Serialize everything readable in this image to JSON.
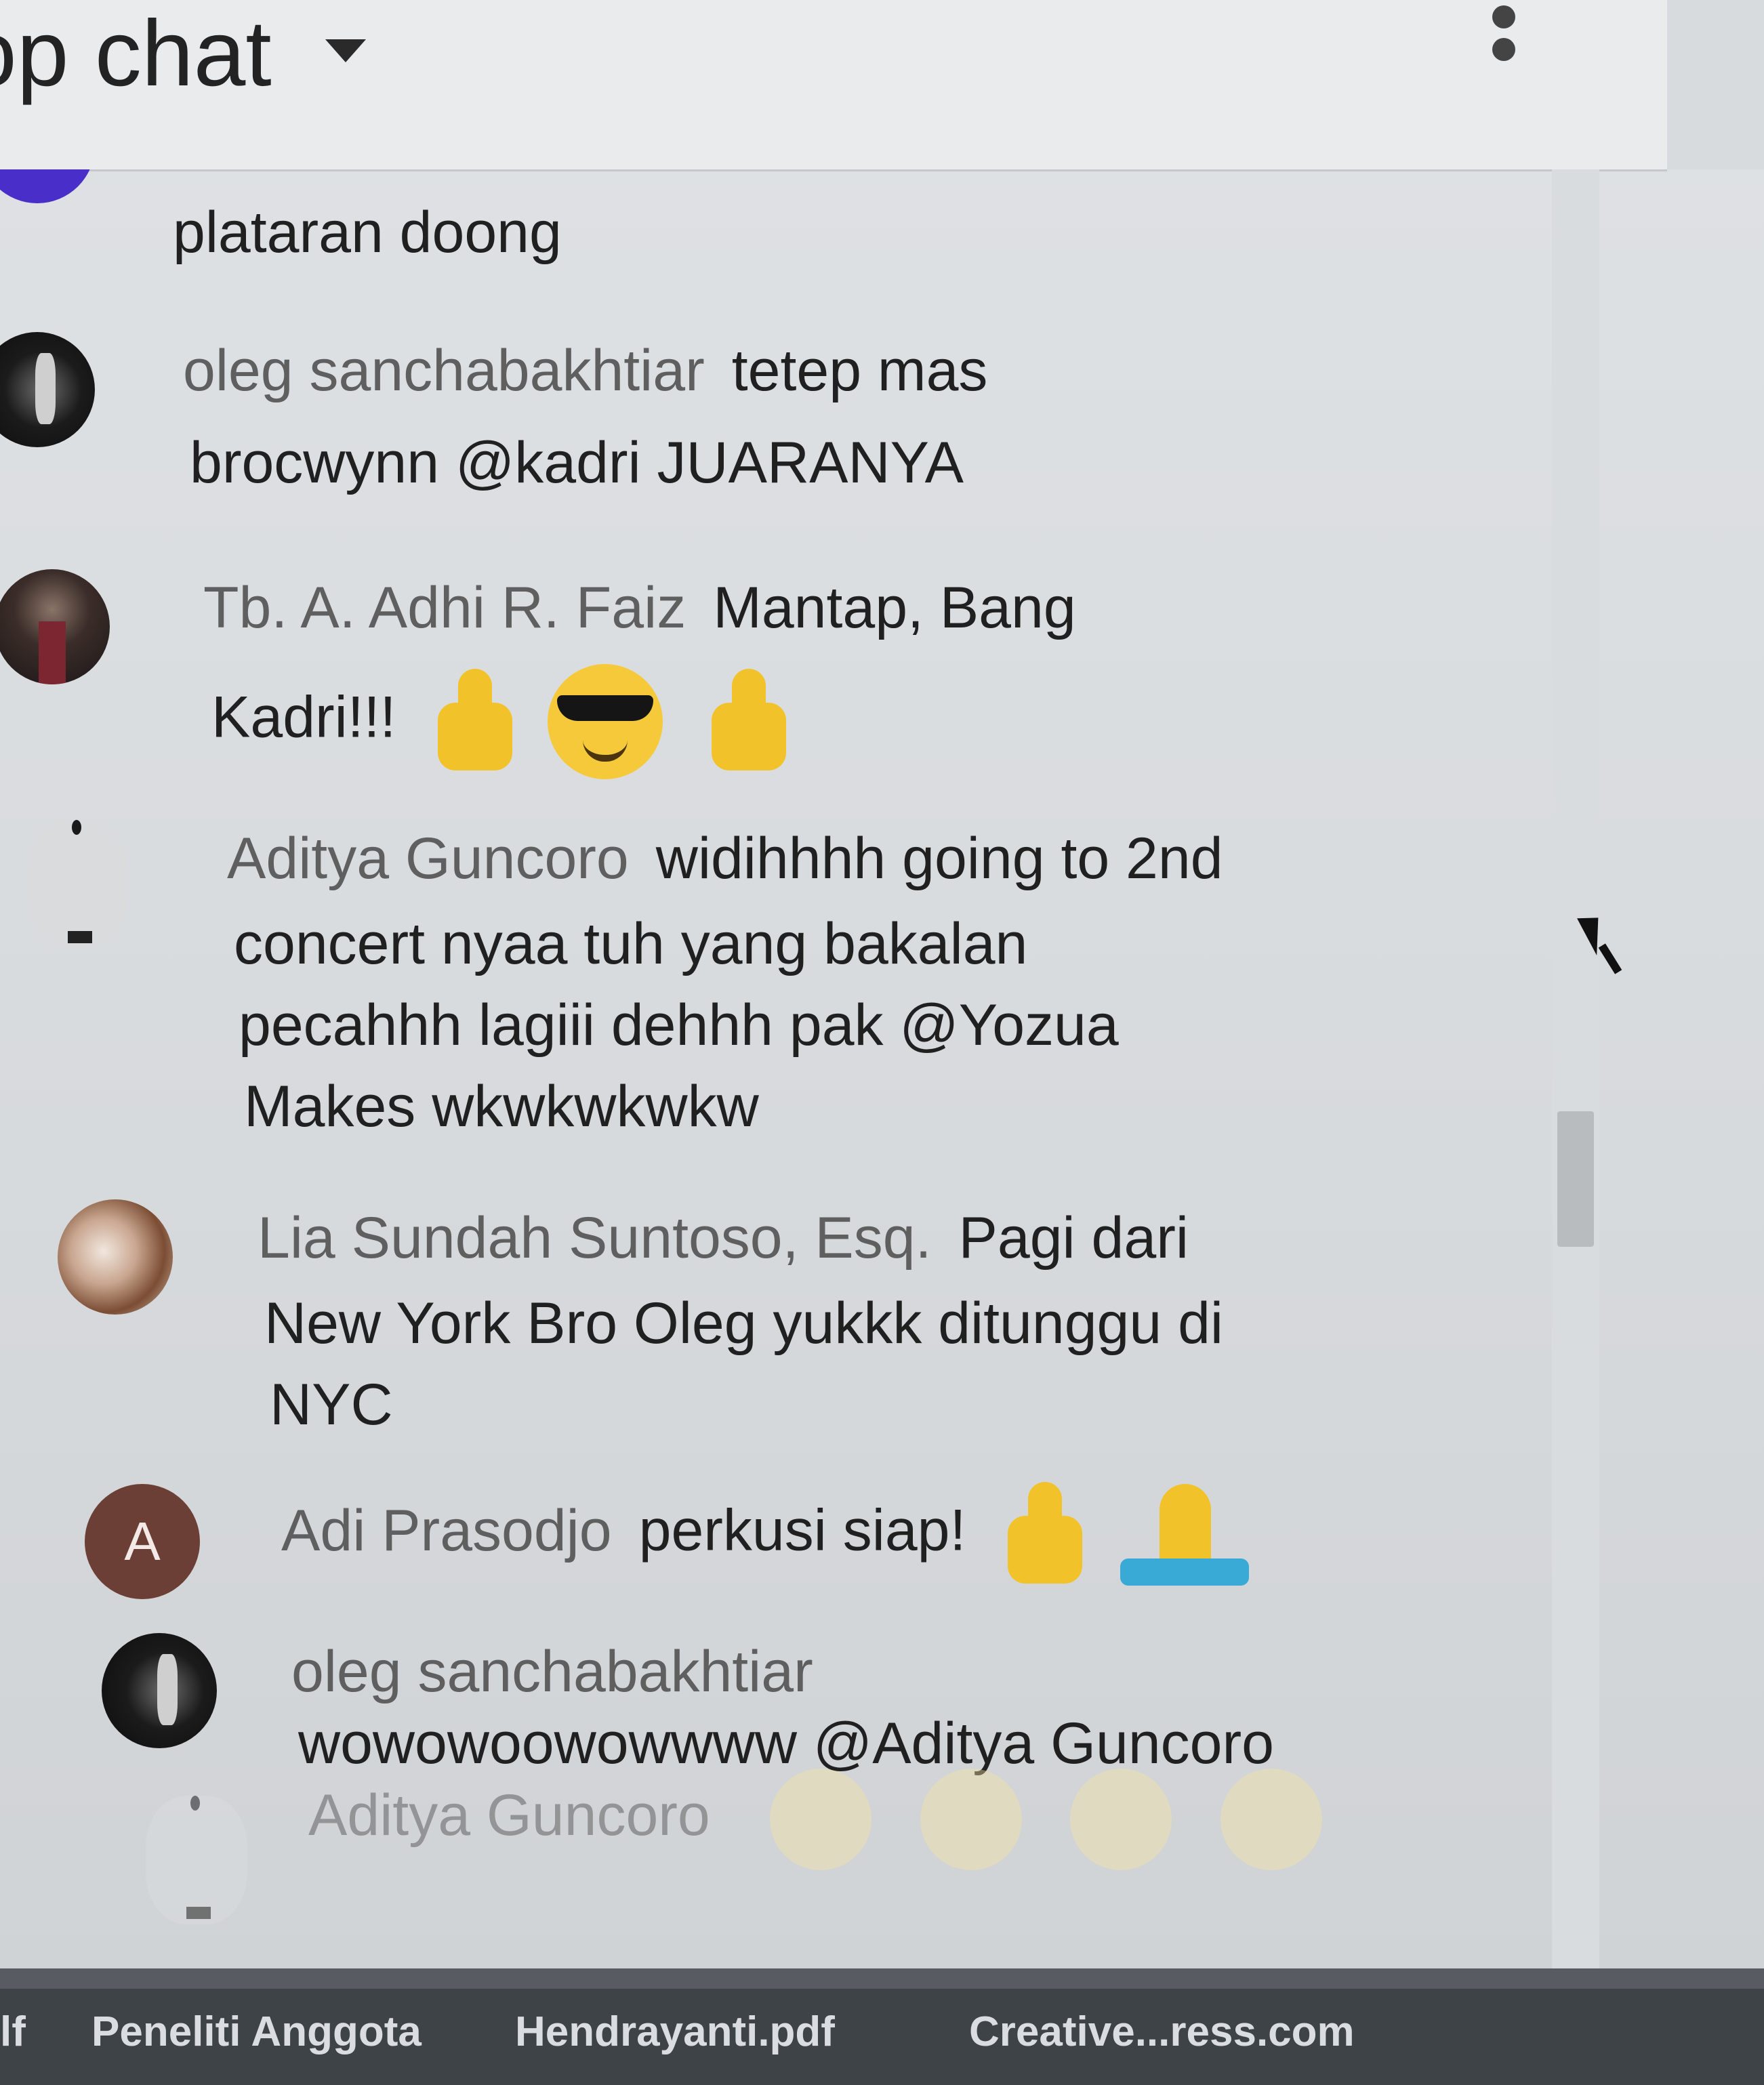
{
  "header": {
    "title": "op chat",
    "dropdown_icon": "caret-down-icon",
    "menu_icon": "more-vertical-icon"
  },
  "messages": [
    {
      "author": "",
      "text": "plataran doong",
      "avatar": "purple"
    },
    {
      "author": "oleg sanchabakhtiar",
      "text": "tetep mas",
      "text2": "brocwynn @kadri JUARANYA",
      "avatar": "dark"
    },
    {
      "author": "Tb. A. Adhi R. Faiz",
      "text": "Mantap, Bang",
      "text2": "Kadri!!!",
      "emojis": [
        "thumbs-up-emoji",
        "sunglasses-emoji",
        "thumbs-up-emoji"
      ],
      "avatar": "suit"
    },
    {
      "author": "Aditya Guncoro",
      "text": "widihhhh going to 2nd",
      "text2": "concert nyaa tuh yang bakalan",
      "text3": "pecahhh lagiii dehhh pak @Yozua",
      "text4": "Makes wkwkwkwkw",
      "avatar": "white"
    },
    {
      "author": "Lia Sundah Suntoso, Esq.",
      "text": "Pagi dari",
      "text2": "New York Bro Oleg yukkk ditunggu di",
      "text3": "NYC",
      "avatar": "photo"
    },
    {
      "author": "Adi Prasodjo",
      "text": "perkusi siap!",
      "emojis": [
        "thumbs-up-emoji",
        "folded-hands-emoji"
      ],
      "avatar": "letter",
      "avatar_letter": "A"
    },
    {
      "author": "oleg sanchabakhtiar",
      "text": "",
      "text2": "wowowoowowwww @Aditya Guncoro",
      "avatar": "dark"
    },
    {
      "author": "Aditya Guncoro",
      "text": "",
      "emojis": [
        "clapping-hands-emoji",
        "clapping-hands-emoji",
        "clapping-hands-emoji",
        "clapping-hands-emoji"
      ],
      "avatar": "white"
    }
  ],
  "taskbar": {
    "items": [
      "lf",
      "Peneliti Anggota",
      "Hendrayanti.pdf",
      "Creative...ress.com"
    ]
  },
  "colors": {
    "author": "#5f5f5f",
    "message": "#202020",
    "header_bg": "#e9ebed",
    "taskbar_bg": "#3e4348"
  }
}
